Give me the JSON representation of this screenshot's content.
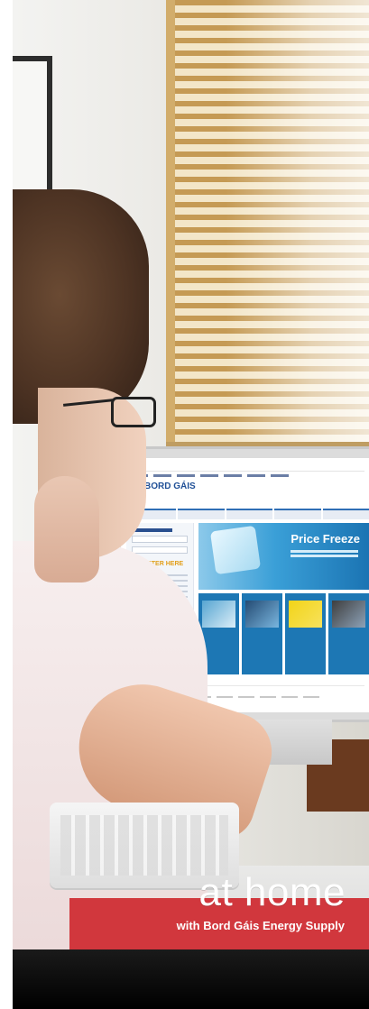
{
  "banner": {
    "headline": "at home",
    "subline": "with Bord Gáis Energy Supply",
    "background_color": "#d1373d",
    "text_color": "#ffffff"
  },
  "screen": {
    "logo_text": "BORD GÁIS",
    "hero_title": "Price Freeze",
    "register_text": "REGISTER HERE"
  }
}
